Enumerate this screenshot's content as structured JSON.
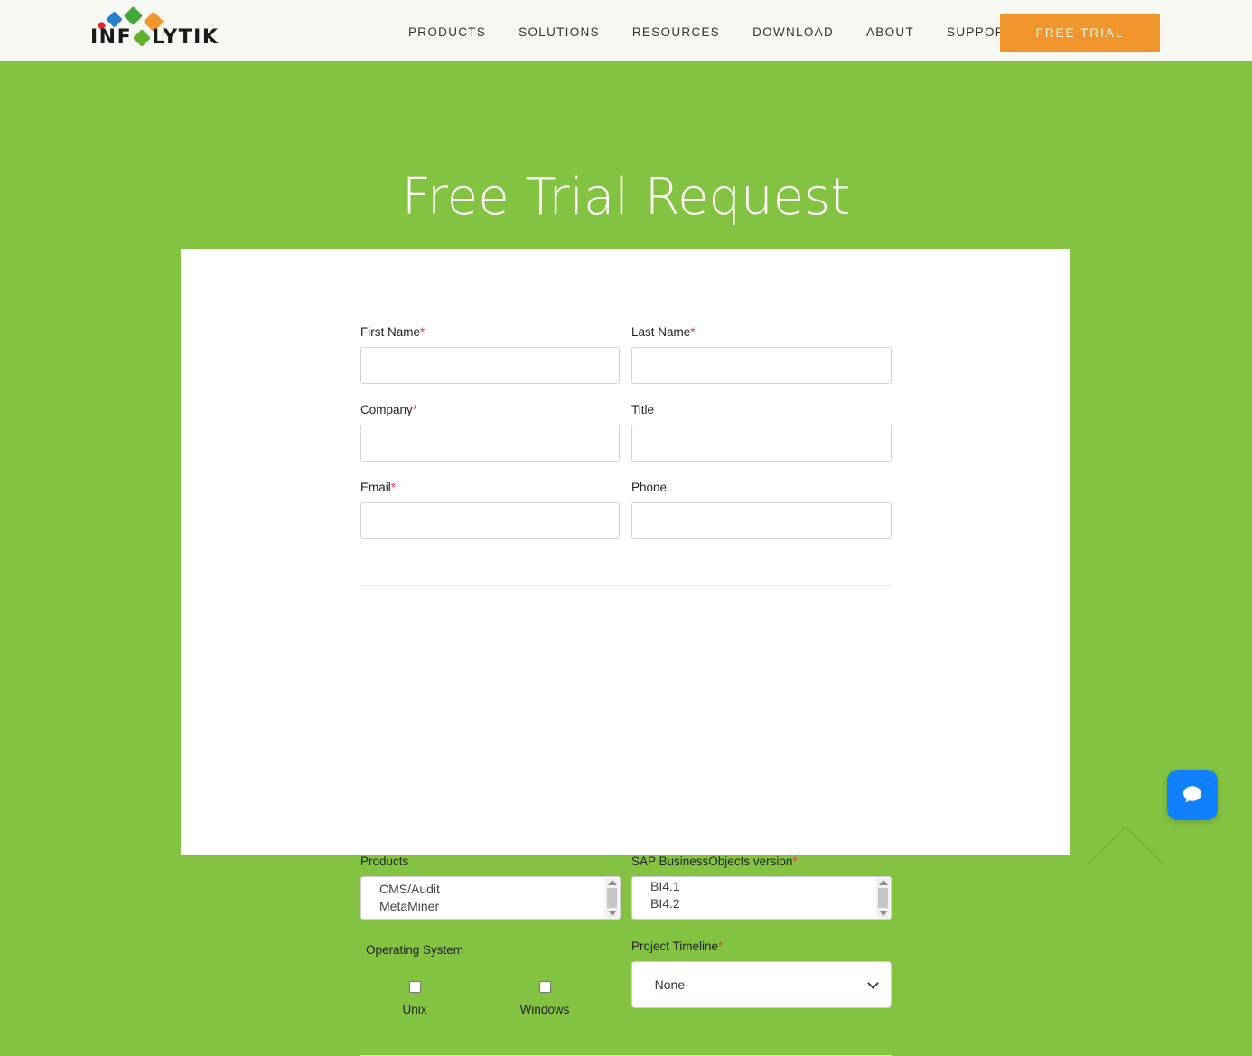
{
  "brand": {
    "logo_text": "INF LYTIK",
    "logo_prefix": "INF",
    "logo_suffix": "LYTIK",
    "accent_green": "#84c341",
    "accent_orange": "#f0962c",
    "header_bg": "#f6f8f1",
    "chat_blue": "#1080ff",
    "required_red": "#e8384f"
  },
  "header": {
    "nav": [
      {
        "label": "PRODUCTS"
      },
      {
        "label": "SOLUTIONS"
      },
      {
        "label": "RESOURCES"
      },
      {
        "label": "DOWNLOAD"
      },
      {
        "label": "ABOUT"
      },
      {
        "label": "SUPPORT"
      }
    ],
    "cta_label": "FREE TRIAL"
  },
  "hero": {
    "title": "Free Trial Request"
  },
  "form": {
    "fields": {
      "first_name": {
        "label": "First Name",
        "required": "*",
        "value": "",
        "placeholder": ""
      },
      "last_name": {
        "label": "Last Name",
        "required": "*",
        "value": "",
        "placeholder": ""
      },
      "company": {
        "label": "Company",
        "required": "*",
        "value": "",
        "placeholder": ""
      },
      "title": {
        "label": "Title",
        "required": "",
        "value": "",
        "placeholder": ""
      },
      "email": {
        "label": "Email",
        "required": "*",
        "value": "",
        "placeholder": ""
      },
      "phone": {
        "label": "Phone",
        "required": "",
        "value": "",
        "placeholder": ""
      }
    },
    "products": {
      "label": "Products",
      "required": "",
      "visible_options": [
        "CMS/Audit",
        "MetaMiner"
      ]
    },
    "sap_version": {
      "label": "SAP BusinessObjects version",
      "required": "*",
      "visible_options": [
        "BI4.1",
        "BI4.2"
      ]
    },
    "operating_system": {
      "label": "Operating System",
      "required": "",
      "options": [
        {
          "label": "Unix",
          "checked": false
        },
        {
          "label": "Windows",
          "checked": false
        }
      ]
    },
    "project_timeline": {
      "label": "Project Timeline",
      "required": "*",
      "selected": "-None-",
      "options": [
        "-None-"
      ]
    }
  },
  "widgets": {
    "chat_label": "chat-bubble-icon",
    "scroll_top_label": "scroll-to-top-chevron"
  }
}
